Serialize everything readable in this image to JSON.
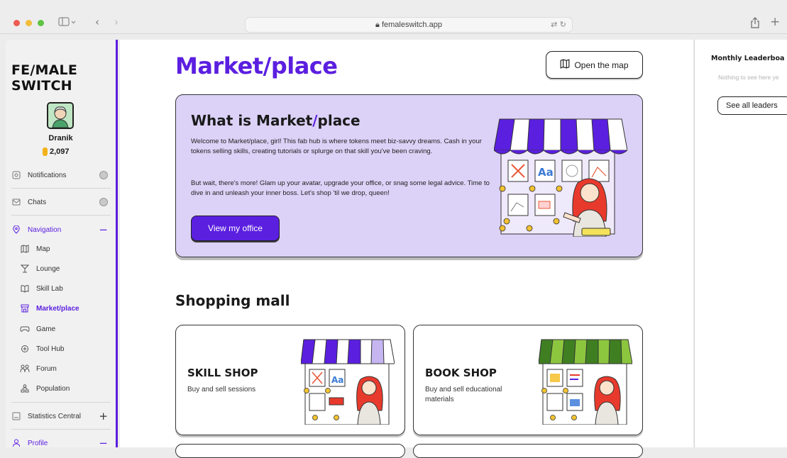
{
  "browser": {
    "url": "femaleswitch.app",
    "back_icon": "chevron-left-icon",
    "forward_icon": "chevron-right-icon"
  },
  "sidebar": {
    "logo": "FE/MALE SWITCH",
    "user": {
      "name": "Dranik",
      "tokens": "2,097"
    },
    "items": [
      {
        "label": "Notifications",
        "icon": "bell-icon"
      },
      {
        "label": "Chats",
        "icon": "chat-icon"
      }
    ],
    "navigation": {
      "label": "Navigation",
      "subitems": [
        {
          "label": "Map",
          "icon": "map-icon"
        },
        {
          "label": "Lounge",
          "icon": "cocktail-icon"
        },
        {
          "label": "Skill Lab",
          "icon": "book-icon"
        },
        {
          "label": "Market/place",
          "icon": "store-icon",
          "active": true
        },
        {
          "label": "Game",
          "icon": "gamepad-icon"
        },
        {
          "label": "Tool Hub",
          "icon": "tool-icon"
        },
        {
          "label": "Forum",
          "icon": "forum-icon"
        },
        {
          "label": "Population",
          "icon": "people-icon"
        }
      ]
    },
    "statistics": {
      "label": "Statistics Central"
    },
    "profile": {
      "label": "Profile"
    }
  },
  "main": {
    "title": "Market/place",
    "open_map_label": "Open the map",
    "hero": {
      "title_part1": "What is Market",
      "title_slash": "/",
      "title_part2": "place",
      "para1": "Welcome to Market/place, girl! This fab hub is where tokens meet biz-savvy dreams. Cash in your tokens selling skills, creating tutorials or splurge on that skill you've been craving.",
      "para2": "But wait, there's more! Glam up your avatar, upgrade your office, or snag some legal advice. Time to dive in and unleash your inner boss. Let's shop 'til we drop, queen!",
      "button": "View my office"
    },
    "section_title": "Shopping mall",
    "shops": [
      {
        "title": "SKILL SHOP",
        "desc": "Buy and sell sessions",
        "awning_color": "#5b1fe0"
      },
      {
        "title": "BOOK SHOP",
        "desc": "Buy and sell educational materials",
        "awning_color": "#4a8a2a"
      }
    ]
  },
  "right_panel": {
    "title": "Monthly Leaderboa",
    "empty_text": "Nothing to see here ye",
    "button": "See all leaders"
  },
  "colors": {
    "accent": "#5b1fe0",
    "hero_bg": "#dcd2f7",
    "book_green": "#4a8a2a"
  }
}
